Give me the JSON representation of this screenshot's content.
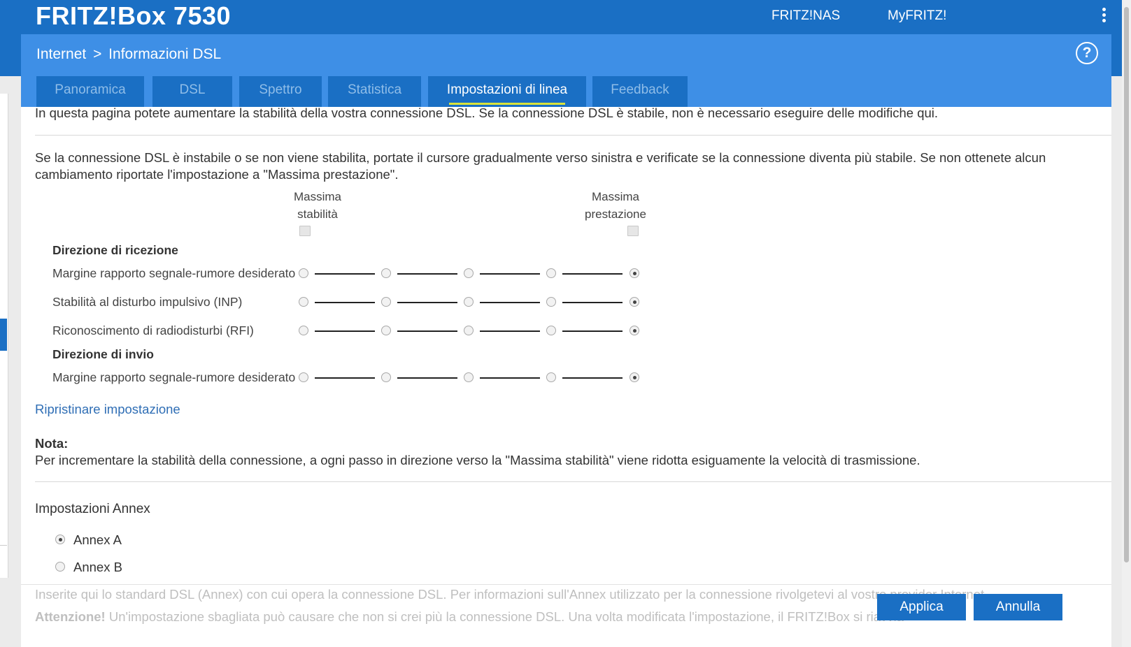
{
  "app": {
    "brand": "FRITZ!Box 7530",
    "top_links": [
      "FRITZ!NAS",
      "MyFRITZ!"
    ]
  },
  "breadcrumb": {
    "section": "Internet",
    "separator": ">",
    "page": "Informazioni DSL"
  },
  "help_glyph": "?",
  "tabs": [
    {
      "label": "Panoramica",
      "active": false
    },
    {
      "label": "DSL",
      "active": false
    },
    {
      "label": "Spettro",
      "active": false
    },
    {
      "label": "Statistica",
      "active": false
    },
    {
      "label": "Impostazioni di linea",
      "active": true
    },
    {
      "label": "Feedback",
      "active": false
    }
  ],
  "intro_text": "In questa pagina potete aumentare la stabilità della vostra connessione DSL. Se la connessione DSL è stabile, non è necessario eseguire delle modifiche qui.",
  "instruction_line1": "Se la connessione DSL è instabile o se non viene stabilita, portate il cursore gradualmente verso sinistra e verificate se la connessione diventa più stabile. Se non ottenete alcun",
  "instruction_line2": "cambiamento riportate l'impostazione a \"Massima prestazione\".",
  "scale": {
    "left_line1": "Massima",
    "left_line2": "stabilità",
    "right_line1": "Massima",
    "right_line2": "prestazione"
  },
  "receive": {
    "heading": "Direzione di ricezione",
    "rows": [
      {
        "label": "Margine rapporto segnale-rumore desiderato",
        "selected_step": 5,
        "steps": 5
      },
      {
        "label": "Stabilità al disturbo impulsivo (INP)",
        "selected_step": 5,
        "steps": 5
      },
      {
        "label": "Riconoscimento di radiodisturbi (RFI)",
        "selected_step": 5,
        "steps": 5
      }
    ]
  },
  "send": {
    "heading": "Direzione di invio",
    "rows": [
      {
        "label": "Margine rapporto segnale-rumore desiderato",
        "selected_step": 5,
        "steps": 5
      }
    ]
  },
  "reset_link": "Ripristinare impostazione",
  "note": {
    "title": "Nota:",
    "text": "Per incrementare la stabilità della connessione, a ogni passo in direzione verso la \"Massima stabilità\" viene ridotta esiguamente la velocità di trasmissione."
  },
  "annex": {
    "heading": "Impostazioni Annex",
    "options": [
      {
        "label": "Annex A",
        "selected": true
      },
      {
        "label": "Annex B",
        "selected": false
      }
    ],
    "info_text": "Inserite qui lo standard DSL (Annex) con cui opera la connessione DSL. Per informazioni sull'Annex utilizzato per la connessione rivolgetevi al vostro provider Internet.",
    "warning_label": "Attenzione!",
    "warning_text": " Un'impostazione sbagliata può causare che non si crei più la connessione DSL. Una volta modificata l'impostazione, il FRITZ!Box si riavvia"
  },
  "buttons": {
    "apply": "Applica",
    "cancel": "Annulla"
  },
  "colors": {
    "topbar": "#1a6fc4",
    "header": "#3e8fe6",
    "tab_active_underline": "#d9e33b",
    "link": "#2f6eb5"
  }
}
